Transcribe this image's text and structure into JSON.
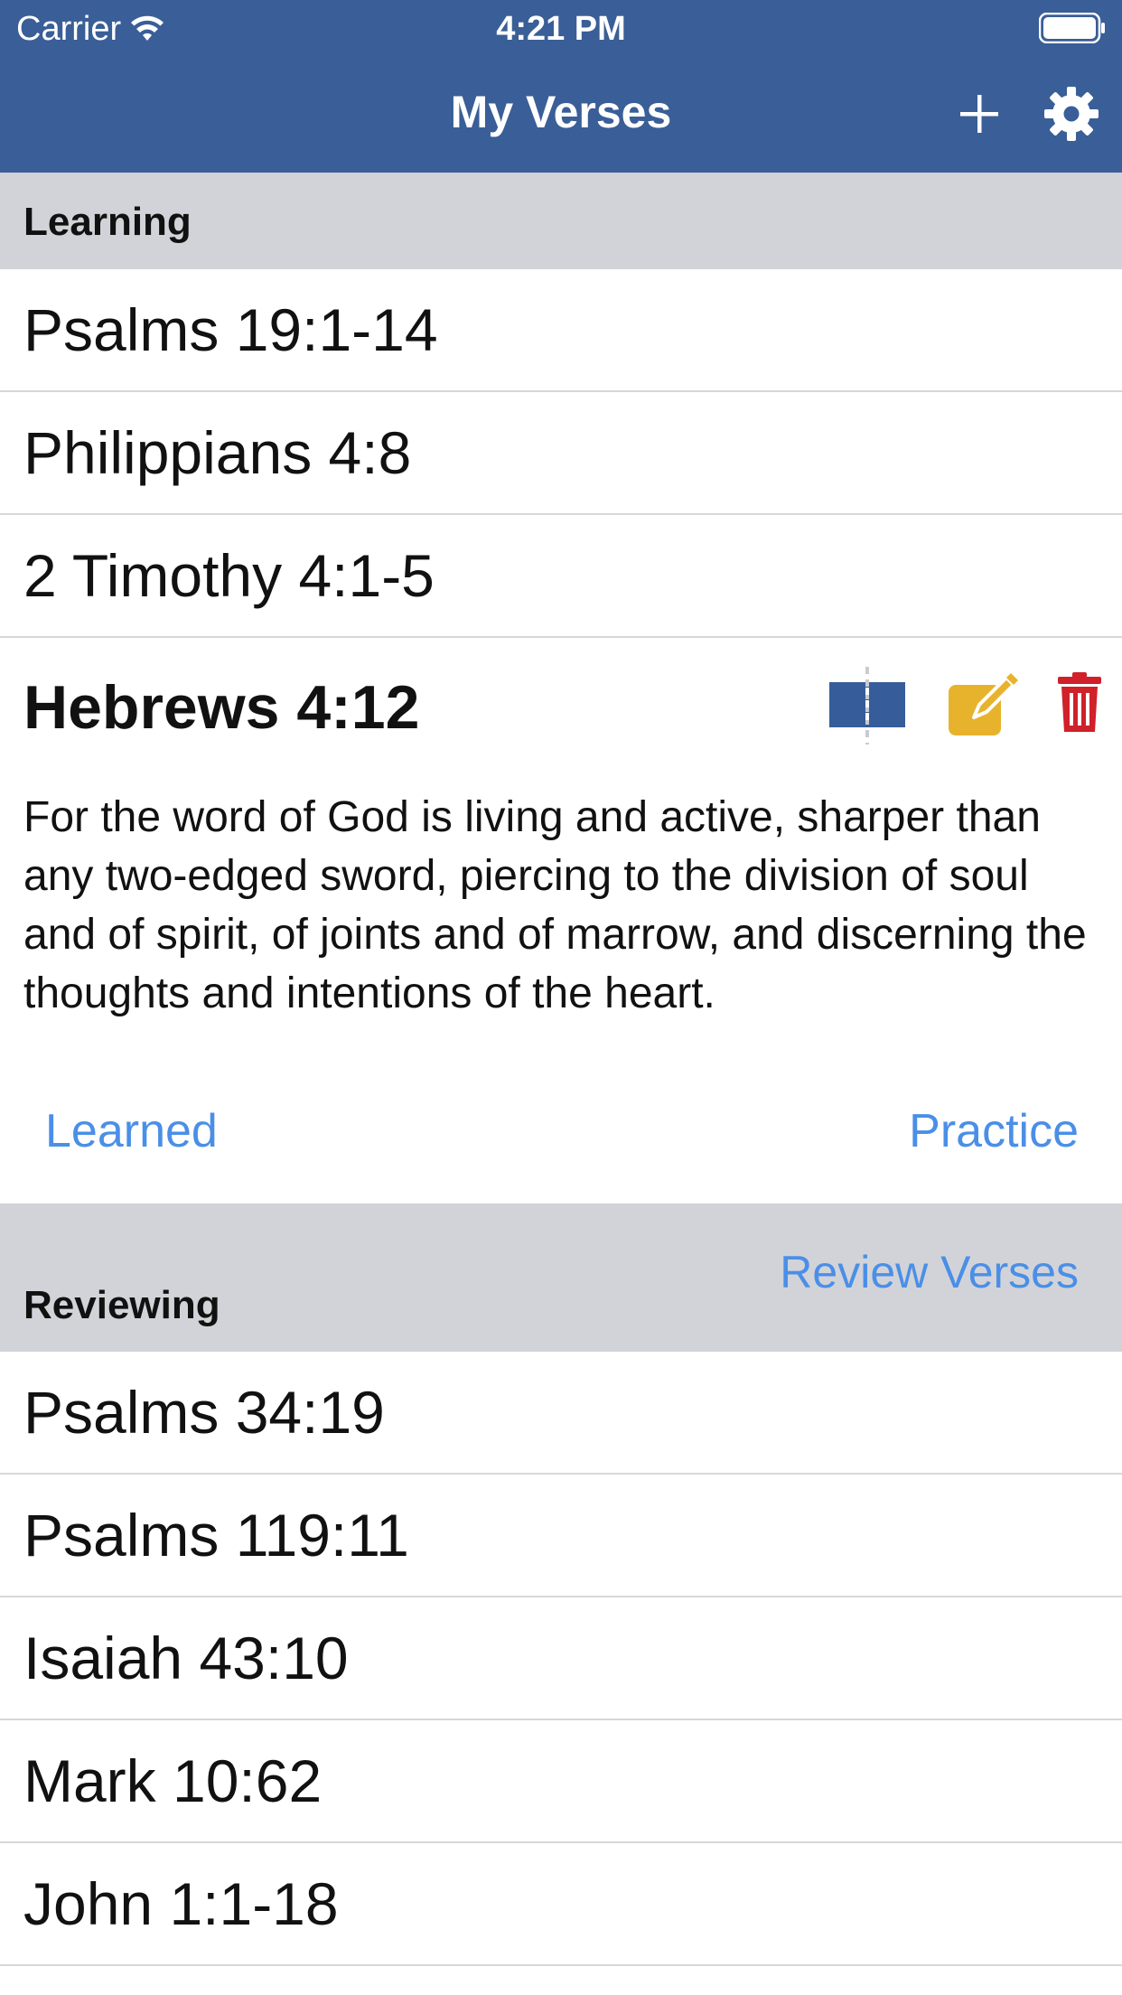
{
  "status_bar": {
    "carrier": "Carrier",
    "time": "4:21 PM"
  },
  "nav": {
    "title": "My Verses",
    "add_icon": "plus-icon",
    "settings_icon": "gear-icon"
  },
  "learning": {
    "title": "Learning",
    "items": [
      "Psalms 19:1-14",
      "Philippians 4:8",
      "2 Timothy 4:1-5"
    ],
    "expanded": {
      "reference": "Hebrews 4:12",
      "text": "For the word of God is living and active, sharper than any two-edged sword, piercing to the division of soul and of spirit, of joints and of marrow, and discerning the thoughts and intentions of the heart.",
      "learned_label": "Learned",
      "practice_label": "Practice",
      "icons": [
        "split-card-icon",
        "edit-icon",
        "trash-icon"
      ]
    }
  },
  "reviewing": {
    "title": "Reviewing",
    "review_label": "Review Verses",
    "items": [
      "Psalms 34:19",
      "Psalms 119:11",
      "Isaiah 43:10",
      "Mark 10:62",
      "John 1:1-18"
    ]
  },
  "colors": {
    "nav_bar": "#3a5e97",
    "section_header": "#d2d3d8",
    "link": "#4a8fe7",
    "split_icon": "#365d99",
    "edit_icon": "#e8b32c",
    "trash_icon": "#d0202a"
  }
}
